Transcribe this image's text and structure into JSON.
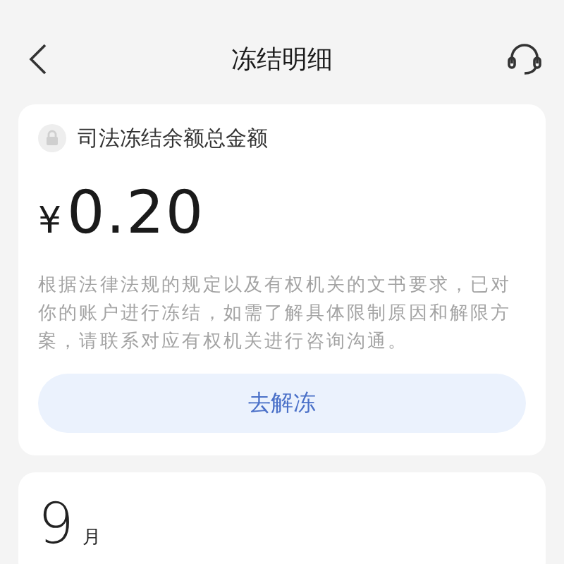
{
  "header": {
    "title": "冻结明细"
  },
  "summary": {
    "label": "司法冻结余额总金额",
    "currency": "¥",
    "amount": "0.20",
    "notice": "根据法律法规的规定以及有权机关的文书要求，已对你的账户进行冻结，如需了解具体限制原因和解限方案，请联系对应有权机关进行咨询沟通。",
    "button": "去解冻"
  },
  "month": {
    "number": "9",
    "unit": "月"
  }
}
